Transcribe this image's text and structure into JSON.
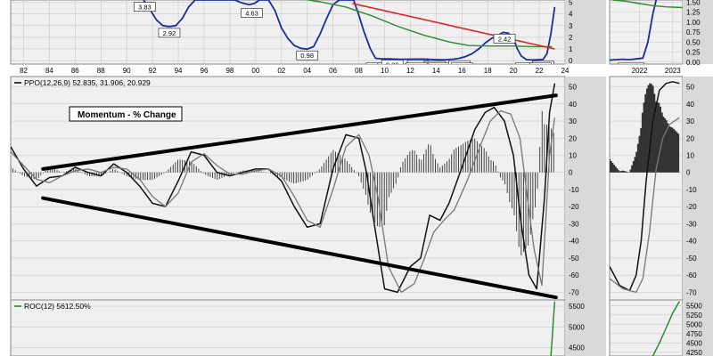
{
  "colors": {
    "background": "#f0f0f0",
    "gutter": "#d9d9d9",
    "grid": "#c9c9c9",
    "rate_line": "#1a2d9c",
    "moving_average": "#2d8a2d",
    "trendline": "#e02020",
    "ppo_line": "#111111",
    "signal_line": "#777777",
    "histogram": "#333333",
    "roc_line": "#2a8a2a",
    "channel_lines": "#000000"
  },
  "chart_data": [
    {
      "type": "line",
      "panel": "rate-main",
      "title": "",
      "x_tick_labels": [
        "82",
        "84",
        "86",
        "88",
        "90",
        "92",
        "94",
        "96",
        "98",
        "00",
        "02",
        "04",
        "06",
        "08",
        "10",
        "12",
        "14",
        "16",
        "18",
        "20",
        "22",
        "24"
      ],
      "xlim": [
        1981,
        2024
      ],
      "y_tick_labels": [
        "5",
        "4",
        "3",
        "2",
        "1",
        "0"
      ],
      "ylim": [
        -0.3,
        5.2
      ],
      "series": [
        {
          "values_x": [
            1991.3,
            1991.8,
            1992.3,
            1992.8,
            1993.3,
            1993.8,
            1994.3,
            1994.8,
            1995.3,
            1996.2,
            1997,
            1998,
            1998.6
          ],
          "values_y": [
            5.2,
            4.4,
            3.5,
            3.0,
            2.92,
            3.0,
            3.6,
            4.6,
            5.2,
            5.2,
            5.2,
            5.2,
            5.2
          ]
        },
        {
          "values_x": [
            1998.4,
            1998.8,
            1999.1,
            1999.5,
            1999.9,
            2000.3,
            2000.6,
            2001.0,
            2001.5,
            2002.0,
            2002.5,
            2003.0,
            2003.5,
            2004.0,
            2004.5,
            2005.0,
            2005.5,
            2006.0,
            2006.5,
            2007.0,
            2007.6,
            2008.0,
            2008.4,
            2008.9,
            2009.3,
            2009.8,
            2010.3,
            2010.8,
            2011.3,
            2011.8,
            2012.3,
            2012.8,
            2013.3,
            2013.8,
            2014.3,
            2014.8,
            2015.3,
            2015.8,
            2016.3,
            2016.8,
            2017.3,
            2017.8,
            2018.3,
            2018.8,
            2019.2,
            2019.6,
            2020.0,
            2020.3,
            2020.6,
            2021.0,
            2021.5,
            2022.0,
            2022.3,
            2022.6,
            2022.9,
            2023.2
          ],
          "values_y": [
            5.2,
            5.0,
            4.9,
            4.8,
            4.9,
            5.2,
            5.2,
            5.2,
            4.3,
            2.8,
            1.9,
            1.3,
            1.05,
            0.98,
            1.2,
            2.3,
            3.6,
            4.8,
            5.2,
            5.2,
            5.2,
            3.9,
            2.5,
            1.0,
            0.2,
            0.15,
            0.14,
            0.13,
            0.11,
            0.12,
            0.13,
            0.13,
            0.12,
            0.09,
            0.07,
            0.08,
            0.12,
            0.2,
            0.35,
            0.6,
            1.0,
            1.5,
            1.9,
            2.2,
            2.42,
            2.35,
            1.9,
            1.0,
            0.4,
            0.08,
            0.05,
            0.08,
            0.1,
            0.6,
            2.3,
            4.6
          ]
        },
        {
          "values_x": [
            2003.5,
            2005,
            2007,
            2009,
            2011,
            2013,
            2015,
            2016.5,
            2018,
            2020,
            2021.5,
            2023
          ],
          "values_y": [
            5.3,
            5.05,
            4.6,
            3.85,
            2.95,
            2.2,
            1.6,
            1.3,
            1.25,
            1.25,
            1.2,
            1.2
          ]
        },
        {
          "values_x": [
            2007.5,
            2023.2
          ],
          "values_y": [
            4.9,
            1.0
          ]
        }
      ],
      "annotations": [
        {
          "x": 1993.3,
          "y": 2.92,
          "text": "2.92"
        },
        {
          "x": 1999.7,
          "y": 4.63,
          "text": "4.63"
        },
        {
          "x": 2004.0,
          "y": 0.98,
          "text": "0.98"
        },
        {
          "x": 2009.4,
          "y": -0.05,
          "text": "0.15"
        },
        {
          "x": 2010.3,
          "y": -0.05,
          "text": "0.11"
        },
        {
          "x": 2010.6,
          "y": 0.2,
          "text": "0.20"
        },
        {
          "x": 2012.6,
          "y": 0.16,
          "text": "0.16"
        },
        {
          "x": 2013.9,
          "y": 0.09,
          "text": "0.09"
        },
        {
          "x": 2012.5,
          "y": -0.05,
          "text": "0.13"
        },
        {
          "x": 2014.2,
          "y": -0.05,
          "text": "0.07"
        },
        {
          "x": 2015.8,
          "y": 0.14,
          "text": "0.14"
        },
        {
          "x": 2016.0,
          "y": -0.05,
          "text": "0.12"
        },
        {
          "x": 2019.3,
          "y": 2.42,
          "text": "2.42"
        },
        {
          "x": 2021.0,
          "y": -0.05,
          "text": "0.05"
        },
        {
          "x": 2022.3,
          "y": 0.1,
          "text": "0.10"
        },
        {
          "x": 2022.1,
          "y": -0.05,
          "text": "0.08"
        },
        {
          "x": 1991.4,
          "y": 5.15,
          "text": "3.83"
        }
      ]
    },
    {
      "type": "line",
      "panel": "rate-zoom",
      "title": "",
      "x_tick_labels": [
        "2022",
        "2023"
      ],
      "xlim": [
        2021.1,
        2023.3
      ],
      "y_tick_labels": [
        "1.50",
        "1.25",
        "1.00",
        "0.75",
        "0.50",
        "0.25",
        "0.00"
      ],
      "ylim": [
        -0.05,
        1.55
      ],
      "series": [
        {
          "values_x": [
            2021.1,
            2021.3,
            2021.5,
            2021.7,
            2021.9,
            2022.1,
            2022.25,
            2022.4,
            2022.5
          ],
          "values_y": [
            0.05,
            0.06,
            0.07,
            0.06,
            0.08,
            0.1,
            0.5,
            1.2,
            1.55
          ]
        },
        {
          "values_x": [
            2021.2,
            2021.6,
            2022.0,
            2022.4,
            2022.8,
            2023.3
          ],
          "values_y": [
            1.55,
            1.52,
            1.46,
            1.41,
            1.38,
            1.36
          ]
        }
      ],
      "annotations": [
        {
          "x": 2021.75,
          "y": 0.02,
          "text": "0.080"
        }
      ]
    },
    {
      "type": "line",
      "panel": "ppo-main",
      "legend": "PPO(12,26,9) 52.835, 31.906, 20.929",
      "annotation_box": "Momentum - % Change",
      "x_tick_labels": [],
      "xlim": [
        1981,
        2024
      ],
      "y_tick_labels": [
        "50",
        "40",
        "30",
        "20",
        "10",
        "0",
        "-10",
        "-20",
        "-30",
        "-40",
        "-50",
        "-60",
        "-70"
      ],
      "ylim": [
        -75,
        56
      ],
      "series": [
        {
          "name": "PPO",
          "values_x": [
            1981,
            1982,
            1983,
            1984,
            1985,
            1986,
            1987,
            1988,
            1989,
            1990,
            1991,
            1992,
            1993,
            1994,
            1995,
            1996,
            1997,
            1998,
            1999,
            2000,
            2001,
            2002,
            2003,
            2004,
            2005,
            2006,
            2007,
            2008,
            2008.6,
            2009.2,
            2010,
            2011,
            2012,
            2012.8,
            2013.5,
            2014.3,
            2015,
            2016,
            2017,
            2017.8,
            2018.5,
            2019.3,
            2020,
            2020.6,
            2021.2,
            2021.8,
            2022.4,
            2022.8,
            2023.2
          ],
          "values_y": [
            15,
            2,
            -8,
            -3,
            -2,
            3,
            0,
            -2,
            5,
            0,
            -8,
            -18,
            -20,
            -5,
            12,
            10,
            0,
            -2,
            0,
            2,
            2,
            -5,
            -20,
            -32,
            -30,
            2,
            22,
            20,
            0,
            -30,
            -68,
            -70,
            -55,
            -50,
            -25,
            -28,
            -18,
            3,
            25,
            35,
            38,
            30,
            10,
            -30,
            -60,
            -68,
            -15,
            35,
            52
          ]
        },
        {
          "name": "Signal",
          "values_x": [
            1981,
            1982,
            1983,
            1984,
            1985,
            1986,
            1987,
            1988,
            1989,
            1990,
            1991,
            1992,
            1993,
            1994,
            1995,
            1996,
            1997,
            1998,
            1999,
            2000,
            2001,
            2002,
            2003,
            2004,
            2005,
            2006,
            2007,
            2008,
            2008.8,
            2009.5,
            2010.3,
            2011.3,
            2012.3,
            2013,
            2013.8,
            2014.6,
            2015.4,
            2016.4,
            2017.4,
            2018.2,
            2019,
            2019.8,
            2020.5,
            2021,
            2021.6,
            2022.2,
            2022.8,
            2023.2
          ],
          "values_y": [
            12,
            4,
            -4,
            -6,
            -2,
            1,
            2,
            0,
            3,
            2,
            -4,
            -14,
            -20,
            -12,
            6,
            11,
            4,
            -1,
            -1,
            1,
            2,
            -2,
            -14,
            -28,
            -32,
            -10,
            15,
            22,
            10,
            -15,
            -55,
            -70,
            -65,
            -52,
            -35,
            -28,
            -22,
            -5,
            15,
            30,
            36,
            34,
            20,
            -10,
            -45,
            -66,
            10,
            32
          ]
        }
      ],
      "trend_channel": {
        "upper": {
          "x": [
            1983.5,
            2023.3
          ],
          "y": [
            2,
            45
          ]
        },
        "lower": {
          "x": [
            1983.5,
            2023.3
          ],
          "y": [
            -15,
            -73
          ]
        }
      }
    },
    {
      "type": "line",
      "panel": "ppo-zoom",
      "title": "",
      "xlim": [
        2021.1,
        2023.3
      ],
      "y_tick_labels": [
        "50",
        "40",
        "30",
        "20",
        "10",
        "0",
        "-10",
        "-20",
        "-30",
        "-40",
        "-50",
        "-60",
        "-70"
      ],
      "ylim": [
        -75,
        56
      ],
      "series": [
        {
          "name": "PPO",
          "values_x": [
            2021.1,
            2021.4,
            2021.7,
            2021.9,
            2022.05,
            2022.2,
            2022.4,
            2022.6,
            2022.8,
            2023.0,
            2023.2
          ],
          "values_y": [
            -55,
            -66,
            -69,
            -60,
            -40,
            -5,
            30,
            48,
            52,
            53,
            52
          ]
        },
        {
          "name": "Signal",
          "values_x": [
            2021.1,
            2021.5,
            2021.9,
            2022.1,
            2022.3,
            2022.5,
            2022.7,
            2022.9,
            2023.2
          ],
          "values_y": [
            -62,
            -68,
            -70,
            -62,
            -35,
            2,
            20,
            28,
            32
          ]
        }
      ]
    },
    {
      "type": "line",
      "panel": "roc-main",
      "legend": "ROC(12) 5612.50%",
      "xlim": [
        1981,
        2024
      ],
      "y_tick_labels": [
        "5500",
        "5000",
        "4500"
      ],
      "ylim": [
        4300,
        5650
      ],
      "series": [
        {
          "name": "ROC(12)",
          "values_x": [
            2022.9,
            2023.0,
            2023.1,
            2023.2
          ],
          "values_y": [
            4300,
            4700,
            5200,
            5612.5
          ]
        }
      ]
    },
    {
      "type": "line",
      "panel": "roc-zoom",
      "xlim": [
        2021.1,
        2023.3
      ],
      "y_tick_labels": [
        "5500",
        "5250",
        "5000",
        "4750",
        "4500",
        "4250"
      ],
      "ylim": [
        4150,
        5650
      ],
      "series": [
        {
          "name": "ROC(12)",
          "values_x": [
            2022.4,
            2022.6,
            2022.8,
            2023.0,
            2023.2
          ],
          "values_y": [
            4150,
            4500,
            4900,
            5300,
            5612.5
          ]
        }
      ]
    }
  ]
}
